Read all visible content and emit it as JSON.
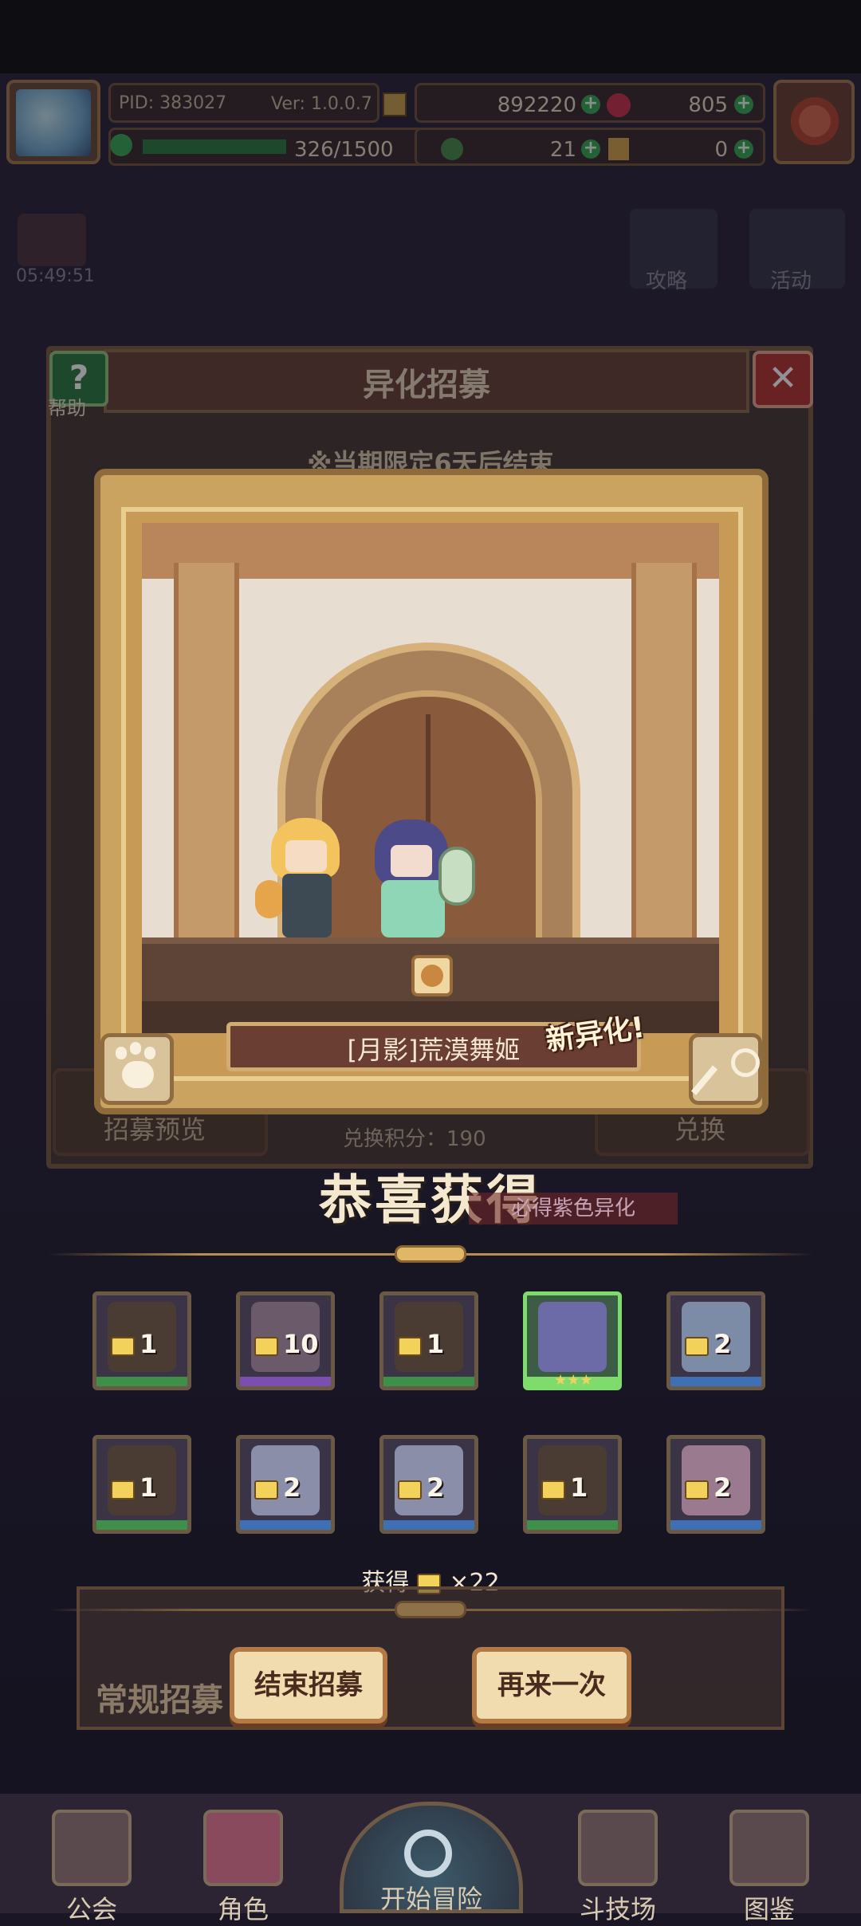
{
  "header": {
    "pid": "PID: 383027",
    "version": "Ver: 1.0.0.7",
    "energy": "326/1500",
    "resource_a": "892220",
    "resource_b": "805",
    "resource_c": "21",
    "resource_d": "0"
  },
  "background": {
    "timer": "05:49:51",
    "guide_label": "攻略",
    "activity_label": "活动"
  },
  "modal": {
    "title": "异化招募",
    "help_label": "帮助",
    "notice": "※当期限定6天后结束",
    "points": "兑换积分：190",
    "preview_label": "招募预览",
    "exchange_label": "兑换",
    "purple_hint": "必得紫色异化"
  },
  "card": {
    "name": "[月影]荒漠舞姬",
    "new_tag": "新异化!"
  },
  "result": {
    "title": "恭喜获得",
    "tiles": [
      {
        "count": "1",
        "bar": "#3e8f4a",
        "portrait": "#4a3c33"
      },
      {
        "count": "10",
        "bar": "#7a4fb0",
        "portrait": "#6b5a6a"
      },
      {
        "count": "1",
        "bar": "#3e8f4a",
        "portrait": "#4a3c33"
      },
      {
        "count": "",
        "bar": "#7ddc6c",
        "portrait": "#6d6aa8",
        "stars": "★★★"
      },
      {
        "count": "2",
        "bar": "#3f6fb4",
        "portrait": "#7d8ca6"
      },
      {
        "count": "1",
        "bar": "#3e8f4a",
        "portrait": "#4a3c33"
      },
      {
        "count": "2",
        "bar": "#3f6fb4",
        "portrait": "#8b8ea8"
      },
      {
        "count": "2",
        "bar": "#3f6fb4",
        "portrait": "#8b8ea8"
      },
      {
        "count": "1",
        "bar": "#3e8f4a",
        "portrait": "#4a3c33"
      },
      {
        "count": "2",
        "bar": "#3f6fb4",
        "portrait": "#9a7a8e"
      }
    ],
    "obtain_prefix": "获得",
    "obtain_count": "×22"
  },
  "actions": {
    "regular_recruit": "常规招募",
    "end_label": "结束招募",
    "again_label": "再来一次"
  },
  "nav": {
    "guild": "公会",
    "character": "角色",
    "adventure": "开始冒险",
    "arena": "斗技场",
    "codex": "图鉴"
  }
}
